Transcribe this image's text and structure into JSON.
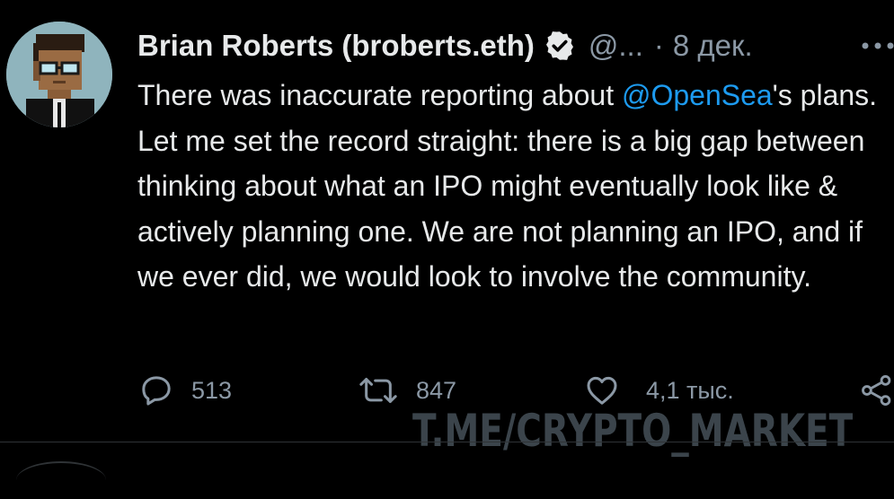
{
  "tweet": {
    "author_name": "Brian Roberts (broberts.eth)",
    "handle": "@...",
    "separator": "·",
    "date": "8 дек.",
    "text_before_mention": "There was inaccurate reporting about ",
    "mention": "@OpenSea",
    "text_after_mention": "'s plans. Let me set the record straight: there is a big gap between thinking about what an IPO might eventually look like & actively planning one. We are not planning an IPO, and if we ever did, we would look to involve the community.",
    "replies": "513",
    "retweets": "847",
    "likes": "4,1 тыс."
  },
  "icons": {
    "verified": "verified-badge-icon",
    "more": "more-options-icon",
    "reply": "reply-icon",
    "retweet": "retweet-icon",
    "like": "heart-icon",
    "share": "share-icon"
  },
  "overlay": {
    "watermark": "T.ME/CRYPTO_MARKET"
  },
  "colors": {
    "background": "#000000",
    "text": "#e7e9ea",
    "muted": "#8b98a5",
    "link": "#1d9bf0",
    "divider": "#2f3336"
  }
}
